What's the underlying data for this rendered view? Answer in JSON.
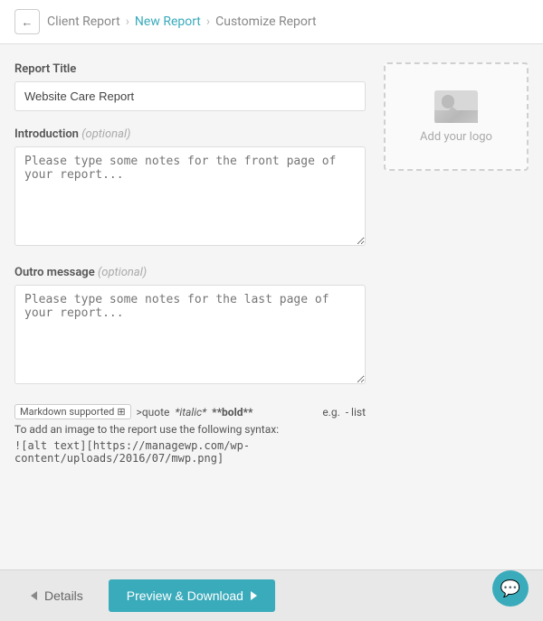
{
  "header": {
    "back_label": "←",
    "breadcrumb": [
      {
        "label": "Client Report",
        "active": false
      },
      {
        "label": "New Report",
        "active": true
      },
      {
        "label": "Customize Report",
        "active": false
      }
    ]
  },
  "form": {
    "report_title_label": "Report Title",
    "report_title_value": "Website Care Report",
    "introduction_label": "Introduction",
    "introduction_optional": "(optional)",
    "introduction_placeholder": "Please type some notes for the front page of your report...",
    "outro_label": "Outro message",
    "outro_optional": "(optional)",
    "outro_placeholder": "Please type some notes for the last page of your report...",
    "logo_label": "Add your logo"
  },
  "markdown": {
    "supported_label": "Markdown supported",
    "syntax_quote": ">quote",
    "syntax_italic": "*italic*",
    "syntax_bold": "**bold**",
    "syntax_eg": "e.g.",
    "syntax_list": "- list",
    "image_note": "To add an image to the report use the following syntax:",
    "image_syntax": "![alt text][https://managewp.com/wp-content/uploads/2016/07/mwp.png]"
  },
  "footer": {
    "details_label": "Details",
    "preview_label": "Preview & Download"
  }
}
